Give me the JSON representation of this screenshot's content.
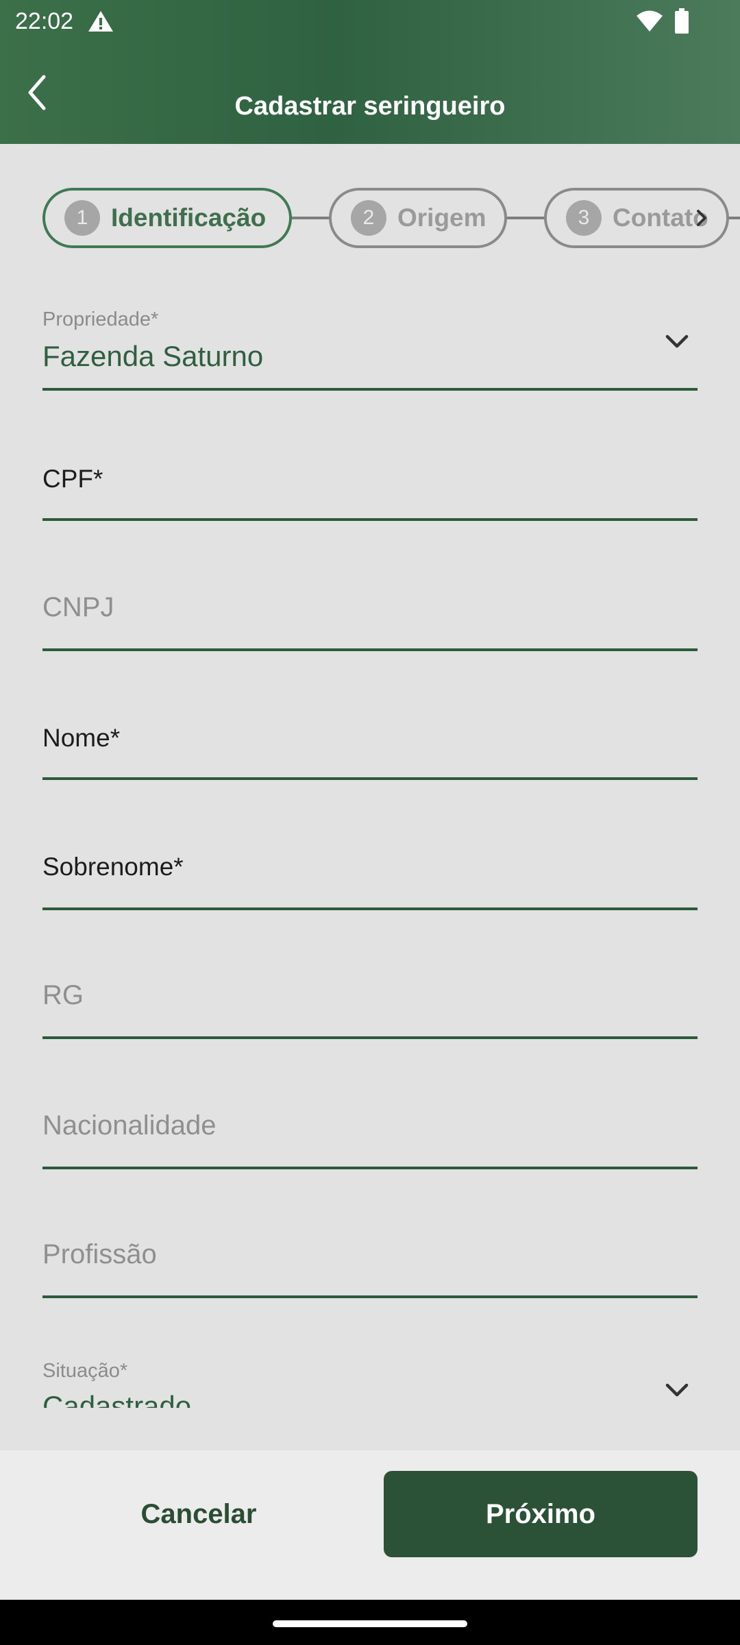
{
  "status_bar": {
    "time": "22:02"
  },
  "header": {
    "title": "Cadastrar seringueiro"
  },
  "stepper": {
    "steps": [
      {
        "number": "1",
        "label": "Identificação"
      },
      {
        "number": "2",
        "label": "Origem"
      },
      {
        "number": "3",
        "label": "Contato"
      }
    ]
  },
  "form": {
    "propriedade": {
      "label": "Propriedade*",
      "value": "Fazenda Saturno"
    },
    "cpf": {
      "label": "CPF*"
    },
    "cnpj": {
      "label": "CNPJ"
    },
    "nome": {
      "label": "Nome*"
    },
    "sobrenome": {
      "label": "Sobrenome*"
    },
    "rg": {
      "label": "RG"
    },
    "nacionalidade": {
      "label": "Nacionalidade"
    },
    "profissao": {
      "label": "Profissão"
    },
    "situacao": {
      "label": "Situação*",
      "value": "Cadastrado"
    }
  },
  "actions": {
    "cancel_label": "Cancelar",
    "next_label": "Próximo"
  },
  "colors": {
    "primary": "#2b5236",
    "header": "#3b7049",
    "accent": "#3f7a53"
  }
}
